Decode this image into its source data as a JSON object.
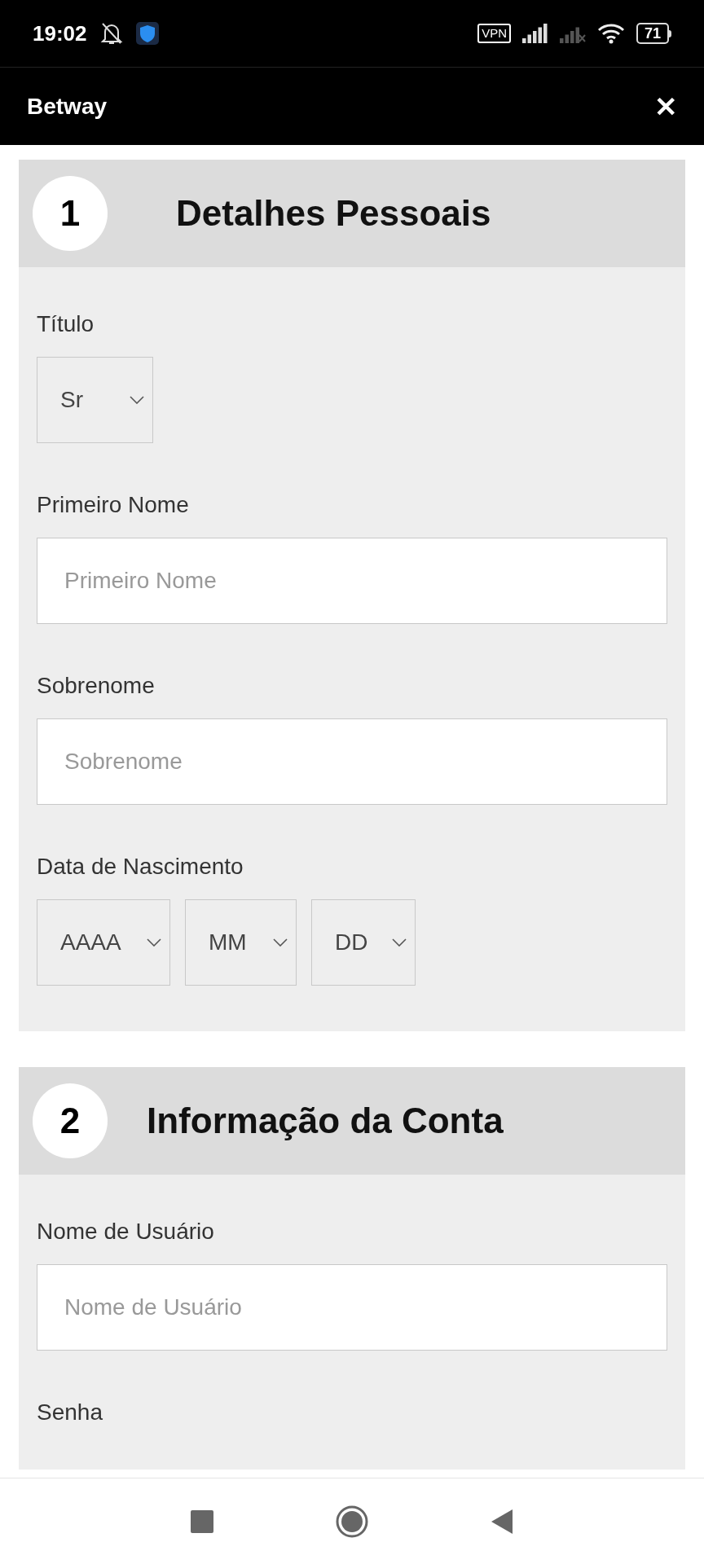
{
  "status_bar": {
    "time": "19:02",
    "vpn": "VPN",
    "battery": "71"
  },
  "app_bar": {
    "title": "Betway",
    "close": "✕"
  },
  "sections": [
    {
      "number": "1",
      "title": "Detalhes Pessoais",
      "fields": [
        {
          "kind": "select_group",
          "label": "Título",
          "selects": [
            {
              "value": "Sr"
            }
          ]
        },
        {
          "kind": "text",
          "label": "Primeiro Nome",
          "placeholder": "Primeiro Nome"
        },
        {
          "kind": "text",
          "label": "Sobrenome",
          "placeholder": "Sobrenome"
        },
        {
          "kind": "select_group",
          "label": "Data de Nascimento",
          "selects": [
            {
              "value": "AAAA"
            },
            {
              "value": "MM"
            },
            {
              "value": "DD"
            }
          ]
        }
      ]
    },
    {
      "number": "2",
      "title": "Informação da Conta",
      "fields": [
        {
          "kind": "text",
          "label": "Nome de Usuário",
          "placeholder": "Nome de Usuário"
        },
        {
          "kind": "label",
          "label": "Senha"
        }
      ]
    }
  ]
}
